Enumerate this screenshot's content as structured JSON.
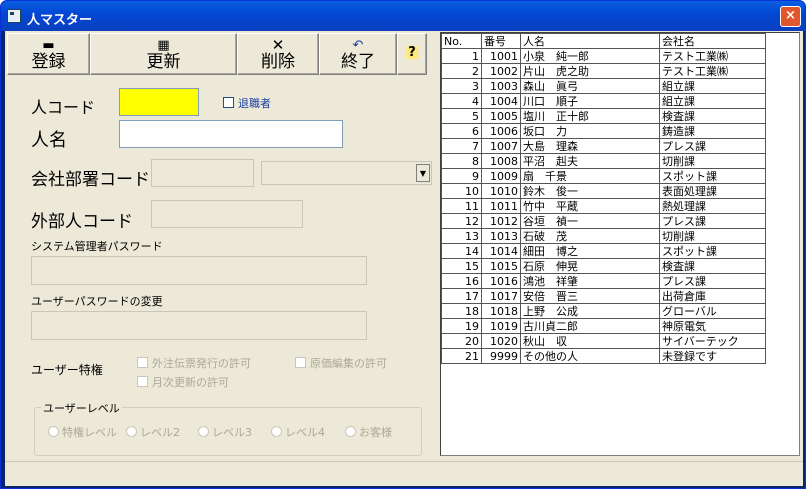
{
  "window": {
    "title": "人マスター",
    "close": "×"
  },
  "toolbar": {
    "register": "登録",
    "update": "更新",
    "delete": "削除",
    "exit": "終了",
    "help": "?"
  },
  "form": {
    "person_code_label": "人コード",
    "retired_label": "退職者",
    "person_name_label": "人名",
    "dept_code_label": "会社部署コード",
    "external_code_label": "外部人コード",
    "admin_password_label": "システム管理者パスワード",
    "user_password_label": "ユーザーパスワードの変更",
    "privilege_label": "ユーザー特権",
    "priv_order": "外注伝票発行の許可",
    "priv_price": "原価編集の許可",
    "priv_monthly": "月次更新の許可",
    "level_group_label": "ユーザーレベル",
    "levels": [
      "特権レベル",
      "レベル2",
      "レベル3",
      "レベル4",
      "お客様"
    ]
  },
  "table": {
    "headers": [
      "No.",
      "番号",
      "人名",
      "会社名"
    ],
    "rows": [
      [
        "1",
        "1001",
        "小泉　純一郎",
        "テスト工業㈱"
      ],
      [
        "2",
        "1002",
        "片山　虎之助",
        "テスト工業㈱"
      ],
      [
        "3",
        "1003",
        "森山　眞弓",
        "組立課"
      ],
      [
        "4",
        "1004",
        "川口　順子",
        "組立課"
      ],
      [
        "5",
        "1005",
        "塩川　正十郎",
        "検査課"
      ],
      [
        "6",
        "1006",
        "坂口　力",
        "鋳造課"
      ],
      [
        "7",
        "1007",
        "大島　理森",
        "プレス課"
      ],
      [
        "8",
        "1008",
        "平沼　赳夫",
        "切削課"
      ],
      [
        "9",
        "1009",
        "扇　千景",
        "スポット課"
      ],
      [
        "10",
        "1010",
        "鈴木　俊一",
        "表面処理課"
      ],
      [
        "11",
        "1011",
        "竹中　平蔵",
        "熱処理課"
      ],
      [
        "12",
        "1012",
        "谷垣　禎一",
        "プレス課"
      ],
      [
        "13",
        "1013",
        "石破　茂",
        "切削課"
      ],
      [
        "14",
        "1014",
        "細田　博之",
        "スポット課"
      ],
      [
        "15",
        "1015",
        "石原　伸晃",
        "検査課"
      ],
      [
        "16",
        "1016",
        "鴻池　祥肇",
        "プレス課"
      ],
      [
        "17",
        "1017",
        "安倍　晋三",
        "出荷倉庫"
      ],
      [
        "18",
        "1018",
        "上野　公成",
        "グローバル"
      ],
      [
        "19",
        "1019",
        "古川貞二郎",
        "神原電気"
      ],
      [
        "20",
        "1020",
        "秋山　収",
        "サイバーテック"
      ],
      [
        "21",
        "9999",
        "その他の人",
        "未登録です"
      ]
    ]
  },
  "colors": {
    "title_bg": "#0248d3",
    "code_field": "#ffff00",
    "client_bg": "#ece9d8"
  }
}
